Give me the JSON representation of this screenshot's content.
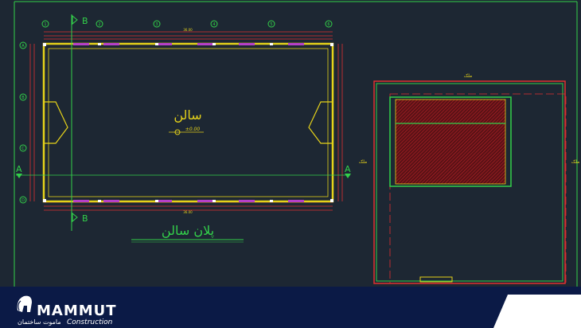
{
  "plan": {
    "section_marker_top": "B",
    "section_marker_bottom": "B",
    "section_marker_left": "A",
    "section_marker_right": "A",
    "grid_columns": [
      "1",
      "2",
      "3",
      "4",
      "5",
      "6",
      "7"
    ],
    "grid_rows": [
      "A",
      "B",
      "C",
      "D"
    ],
    "room_label": "سالن",
    "elevation_label": "±0.00",
    "plan_title": "پلان سالن",
    "overall_dim": "36.00",
    "inner_dim": "35.00"
  },
  "site": {
    "neighbor_top": "ملک",
    "neighbor_left": "ملک",
    "neighbor_right": "ملک"
  },
  "footer": {
    "brand_name": "MAMMUT",
    "brand_tagline": "Construction",
    "brand_fa": "ماموت ساختمان"
  },
  "colors": {
    "background": "#1d2733",
    "wall": "#e5d21a",
    "dimension": "#e03030",
    "grid": "#33d04a",
    "accent": "#ff3b3b",
    "footer": "#0b1a46"
  }
}
